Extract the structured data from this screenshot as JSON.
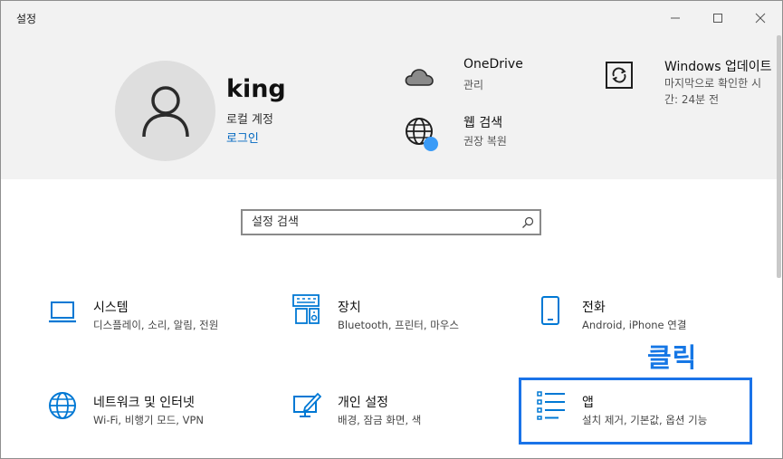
{
  "window": {
    "title": "설정",
    "controls": {
      "minimize_icon": "minimize-icon",
      "maximize_icon": "maximize-icon",
      "close_icon": "close-icon"
    }
  },
  "account": {
    "name": "king",
    "type": "로컬 계정",
    "login_link": "로그인"
  },
  "header_items": {
    "onedrive": {
      "title": "OneDrive",
      "subtitle": "관리",
      "icon": "cloud-icon"
    },
    "websearch": {
      "title": "웹 검색",
      "subtitle": "권장 복원",
      "icon": "globe-icon"
    },
    "update": {
      "title": "Windows 업데이트",
      "subtitle_line1": "마지막으로 확인한 시",
      "subtitle_line2": "간: 24분 전",
      "icon": "sync-icon"
    }
  },
  "search": {
    "placeholder": "설정 검색",
    "icon": "search-icon"
  },
  "categories": {
    "system": {
      "title": "시스템",
      "subtitle": "디스플레이, 소리, 알림, 전원",
      "icon": "laptop-icon"
    },
    "devices": {
      "title": "장치",
      "subtitle": "Bluetooth, 프린터, 마우스",
      "icon": "devices-icon"
    },
    "phone": {
      "title": "전화",
      "subtitle": "Android, iPhone 연결",
      "icon": "phone-icon"
    },
    "network": {
      "title": "네트워크 및 인터넷",
      "subtitle": "Wi-Fi, 비행기 모드, VPN",
      "icon": "globe-icon"
    },
    "personalization": {
      "title": "개인 설정",
      "subtitle": "배경, 잠금 화면, 색",
      "icon": "personalization-icon"
    },
    "apps": {
      "title": "앱",
      "subtitle": "설치 제거, 기본값, 옵션 기능",
      "icon": "apps-list-icon"
    }
  },
  "annotation": {
    "text": "클릭",
    "color": "#1677e5"
  },
  "colors": {
    "accent": "#0067c0",
    "header_bg": "#f2f2f2",
    "icon_blue": "#0078d4",
    "highlight": "#1a73e8"
  }
}
